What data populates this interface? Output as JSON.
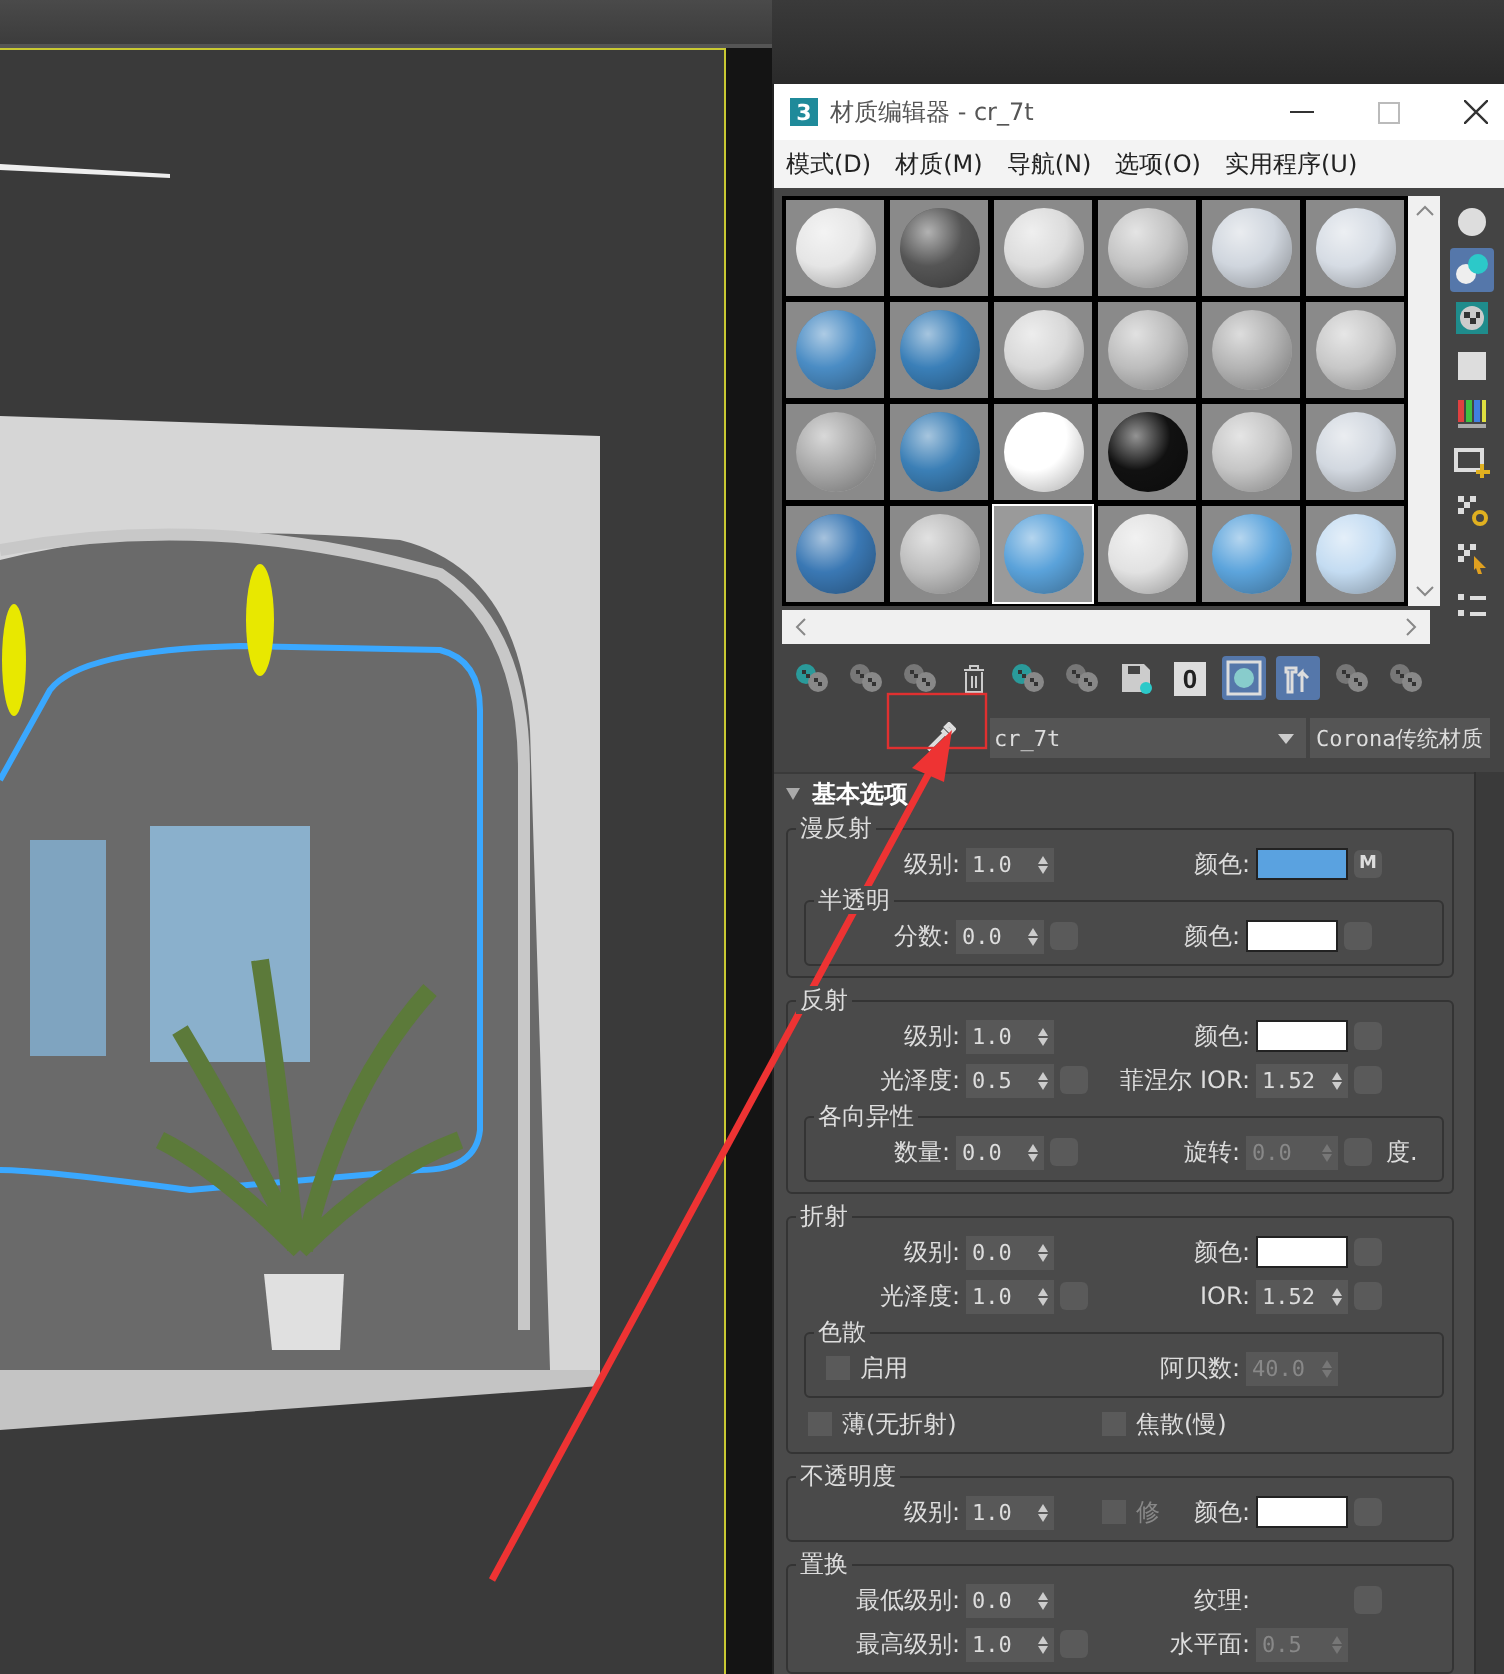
{
  "window": {
    "app_icon": "3",
    "title": "材质编辑器 - cr_7t"
  },
  "menu": [
    {
      "label": "模式(D)"
    },
    {
      "label": "材质(M)"
    },
    {
      "label": "导航(N)"
    },
    {
      "label": "选项(O)"
    },
    {
      "label": "实用程序(U)"
    }
  ],
  "slots": [
    {
      "color": "#e6e6e6",
      "selected": false
    },
    {
      "color": "#555555",
      "selected": false
    },
    {
      "color": "#dcdcdc",
      "selected": false
    },
    {
      "color": "#c4c4c4",
      "selected": false
    },
    {
      "color": "#d0d6de",
      "selected": false
    },
    {
      "color": "#d6dce4",
      "selected": false
    },
    {
      "color": "#4a8cc4",
      "selected": false
    },
    {
      "color": "#3a7fb8",
      "selected": false
    },
    {
      "color": "#d8d8d8",
      "selected": false
    },
    {
      "color": "#bdbdbd",
      "selected": false
    },
    {
      "color": "#b4b4b4",
      "selected": false
    },
    {
      "color": "#c8c8c8",
      "selected": false
    },
    {
      "color": "#aaaaaa",
      "selected": false
    },
    {
      "color": "#3b7fb6",
      "selected": false
    },
    {
      "color": "#ffffff",
      "selected": false
    },
    {
      "color": "#111111",
      "selected": false
    },
    {
      "color": "#c6c6c6",
      "selected": false
    },
    {
      "color": "#d2d8e0",
      "selected": false
    },
    {
      "color": "#3a78b4",
      "selected": false
    },
    {
      "color": "#bebebe",
      "selected": false
    },
    {
      "color": "#5aa2da",
      "selected": true
    },
    {
      "color": "#e2e2e2",
      "selected": false
    },
    {
      "color": "#5ca4dc",
      "selected": false
    },
    {
      "color": "#c4dcf2",
      "selected": false
    }
  ],
  "side_tools": [
    {
      "kind": "sphere",
      "active": false
    },
    {
      "kind": "spheres",
      "active": true
    },
    {
      "kind": "checker-teal",
      "active": false
    },
    {
      "kind": "square",
      "active": false
    },
    {
      "kind": "bars",
      "active": false
    },
    {
      "kind": "film",
      "active": false
    },
    {
      "kind": "checker-gear",
      "active": false
    },
    {
      "kind": "checker-cursor",
      "active": false
    },
    {
      "kind": "list",
      "active": false
    }
  ],
  "toolbar": [
    {
      "kind": "checker-teal",
      "active": false
    },
    {
      "kind": "checker",
      "active": false
    },
    {
      "kind": "checker",
      "active": false
    },
    {
      "kind": "trash",
      "active": false
    },
    {
      "kind": "checker-teal",
      "active": false
    },
    {
      "kind": "checker",
      "active": false
    },
    {
      "kind": "save",
      "active": false
    },
    {
      "kind": "number",
      "label": "0",
      "active": false
    },
    {
      "kind": "frame",
      "active": true
    },
    {
      "kind": "tool",
      "active": true
    },
    {
      "kind": "checker",
      "active": false
    },
    {
      "kind": "checker",
      "active": false
    }
  ],
  "material": {
    "name": "cr_7t",
    "type": "Corona传统材质"
  },
  "rollout": {
    "title": "基本选项",
    "expanded": true,
    "groups": [
      {
        "title": "漫反射",
        "rows": [
          {
            "label": "级别:",
            "value": "1.0",
            "label2": "颜色:",
            "color": "#5aa2e0",
            "map2": true,
            "map2_label": "M"
          }
        ],
        "sub": {
          "title": "半透明",
          "rows": [
            {
              "label": "分数:",
              "value": "0.0",
              "map": true,
              "label2": "颜色:",
              "color": "#ffffff",
              "map2": true
            }
          ]
        }
      },
      {
        "title": "反射",
        "rows": [
          {
            "label": "级别:",
            "value": "1.0",
            "label2": "颜色:",
            "color": "#ffffff",
            "map2": true
          },
          {
            "label": "光泽度:",
            "value": "0.5",
            "map": true,
            "label2": "菲涅尔 IOR:",
            "value2": "1.52",
            "value2_disabled": false,
            "map2": true
          }
        ],
        "sub": {
          "title": "各向异性",
          "rows": [
            {
              "label": "数量:",
              "value": "0.0",
              "map": true,
              "label2": "旋转:",
              "value2": "0.0",
              "value2_disabled": true,
              "map2": true,
              "suffix": "度."
            }
          ]
        }
      },
      {
        "title": "折射",
        "rows": [
          {
            "label": "级别:",
            "value": "0.0",
            "label2": "颜色:",
            "color": "#ffffff",
            "map2": true
          },
          {
            "label": "光泽度:",
            "value": "1.0",
            "map": true,
            "label2": "IOR:",
            "value2": "1.52",
            "value2_disabled": false,
            "map2": true
          }
        ],
        "sub": {
          "title": "色散",
          "rows": [
            {
              "check": {
                "label": "启用",
                "checked": false
              },
              "label2": "阿贝数:",
              "value2": "40.0",
              "value2_disabled": true
            }
          ]
        },
        "after": [
          {
            "check": {
              "label": "薄(无折射)",
              "checked": false
            },
            "check2": {
              "label": "焦散(慢)",
              "checked": false
            }
          }
        ]
      },
      {
        "title": "不透明度",
        "rows": [
          {
            "label": "级别:",
            "value": "1.0",
            "check_mid": {
              "label": "修",
              "checked": false
            },
            "label2": "颜色:",
            "color": "#ffffff",
            "map2": true
          }
        ]
      },
      {
        "title": "置换",
        "rows": [
          {
            "label": "最低级别:",
            "value": "0.0",
            "label2": "纹理:",
            "map2": true
          },
          {
            "label": "最高级别:",
            "value": "1.0",
            "map": true,
            "label2": "水平面:",
            "value2": "0.5",
            "value2_disabled": true
          }
        ]
      }
    ]
  }
}
